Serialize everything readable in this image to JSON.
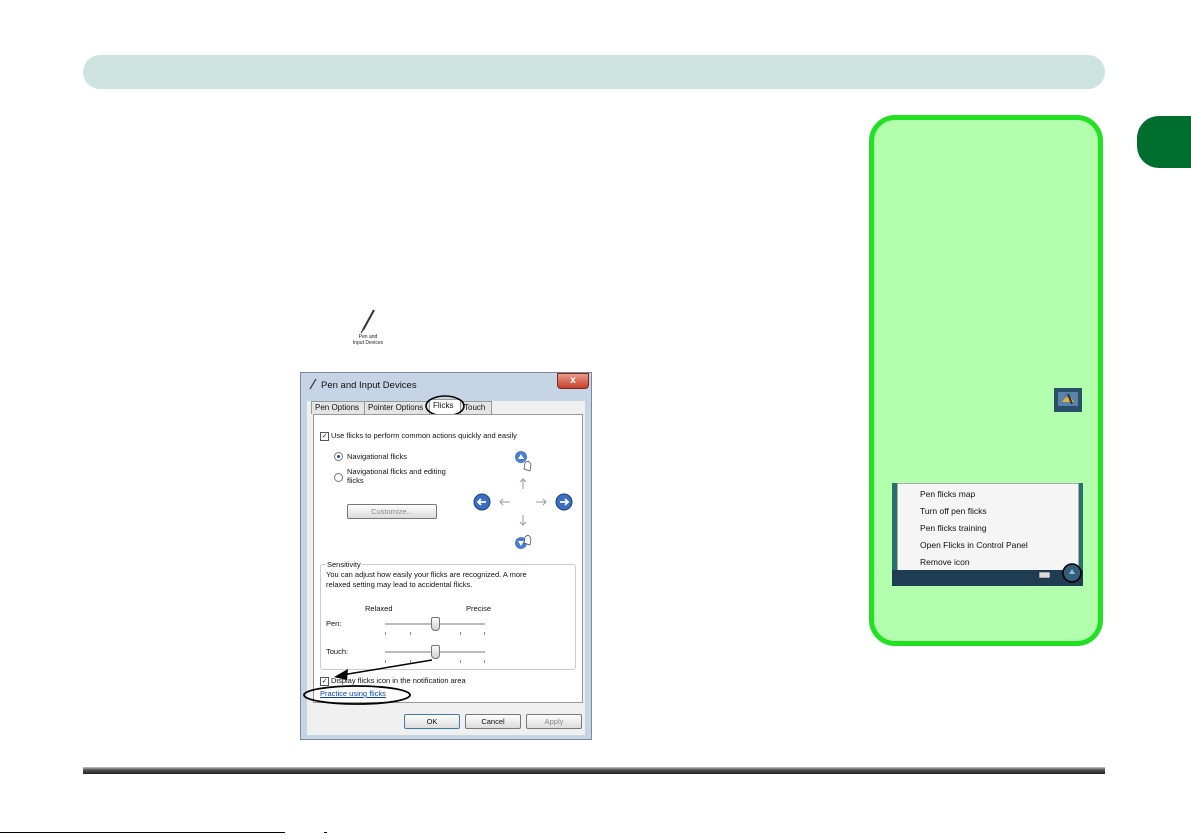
{
  "dialog": {
    "title": "Pen and Input Devices",
    "close_label": "x",
    "tabs": [
      {
        "label": "Pen Options"
      },
      {
        "label": "Pointer Options"
      },
      {
        "label": "Flicks",
        "active": true
      },
      {
        "label": "Touch"
      }
    ],
    "use_flicks_label": "Use flicks to perform common actions quickly and easily",
    "use_flicks_checked": true,
    "radio_navigational": "Navigational flicks",
    "radio_navigational_editing_1": "Navigational flicks and editing",
    "radio_navigational_editing_2": "flicks",
    "customize_label": "Customize...",
    "sensitivity": {
      "legend": "Sensitivity",
      "desc_1": "You can adjust how easily your flicks are recognized. A more",
      "desc_2": "relaxed setting may lead to accidental flicks.",
      "relaxed": "Relaxed",
      "precise": "Precise",
      "pen_label": "Pen:",
      "touch_label": "Touch:",
      "pen_value_fraction": 0.5,
      "touch_value_fraction": 0.5
    },
    "display_icon_label": "Display flicks icon in the notification area",
    "display_icon_checked": true,
    "practice_link": "Practice using flicks",
    "ok_label": "OK",
    "cancel_label": "Cancel",
    "apply_label": "Apply"
  },
  "control_panel_icon": {
    "label_1": "Pen and",
    "label_2": "Input Devices"
  },
  "context_menu": {
    "items": [
      "Pen flicks map",
      "Turn off pen flicks",
      "Pen flicks training",
      "Open Flicks in Control Panel",
      "Remove icon"
    ]
  },
  "colors": {
    "header_bar": "#cde3dd",
    "chapter_tab": "#006e2c",
    "sidebar_fill": "#b2ffae",
    "sidebar_border": "#22e022"
  }
}
